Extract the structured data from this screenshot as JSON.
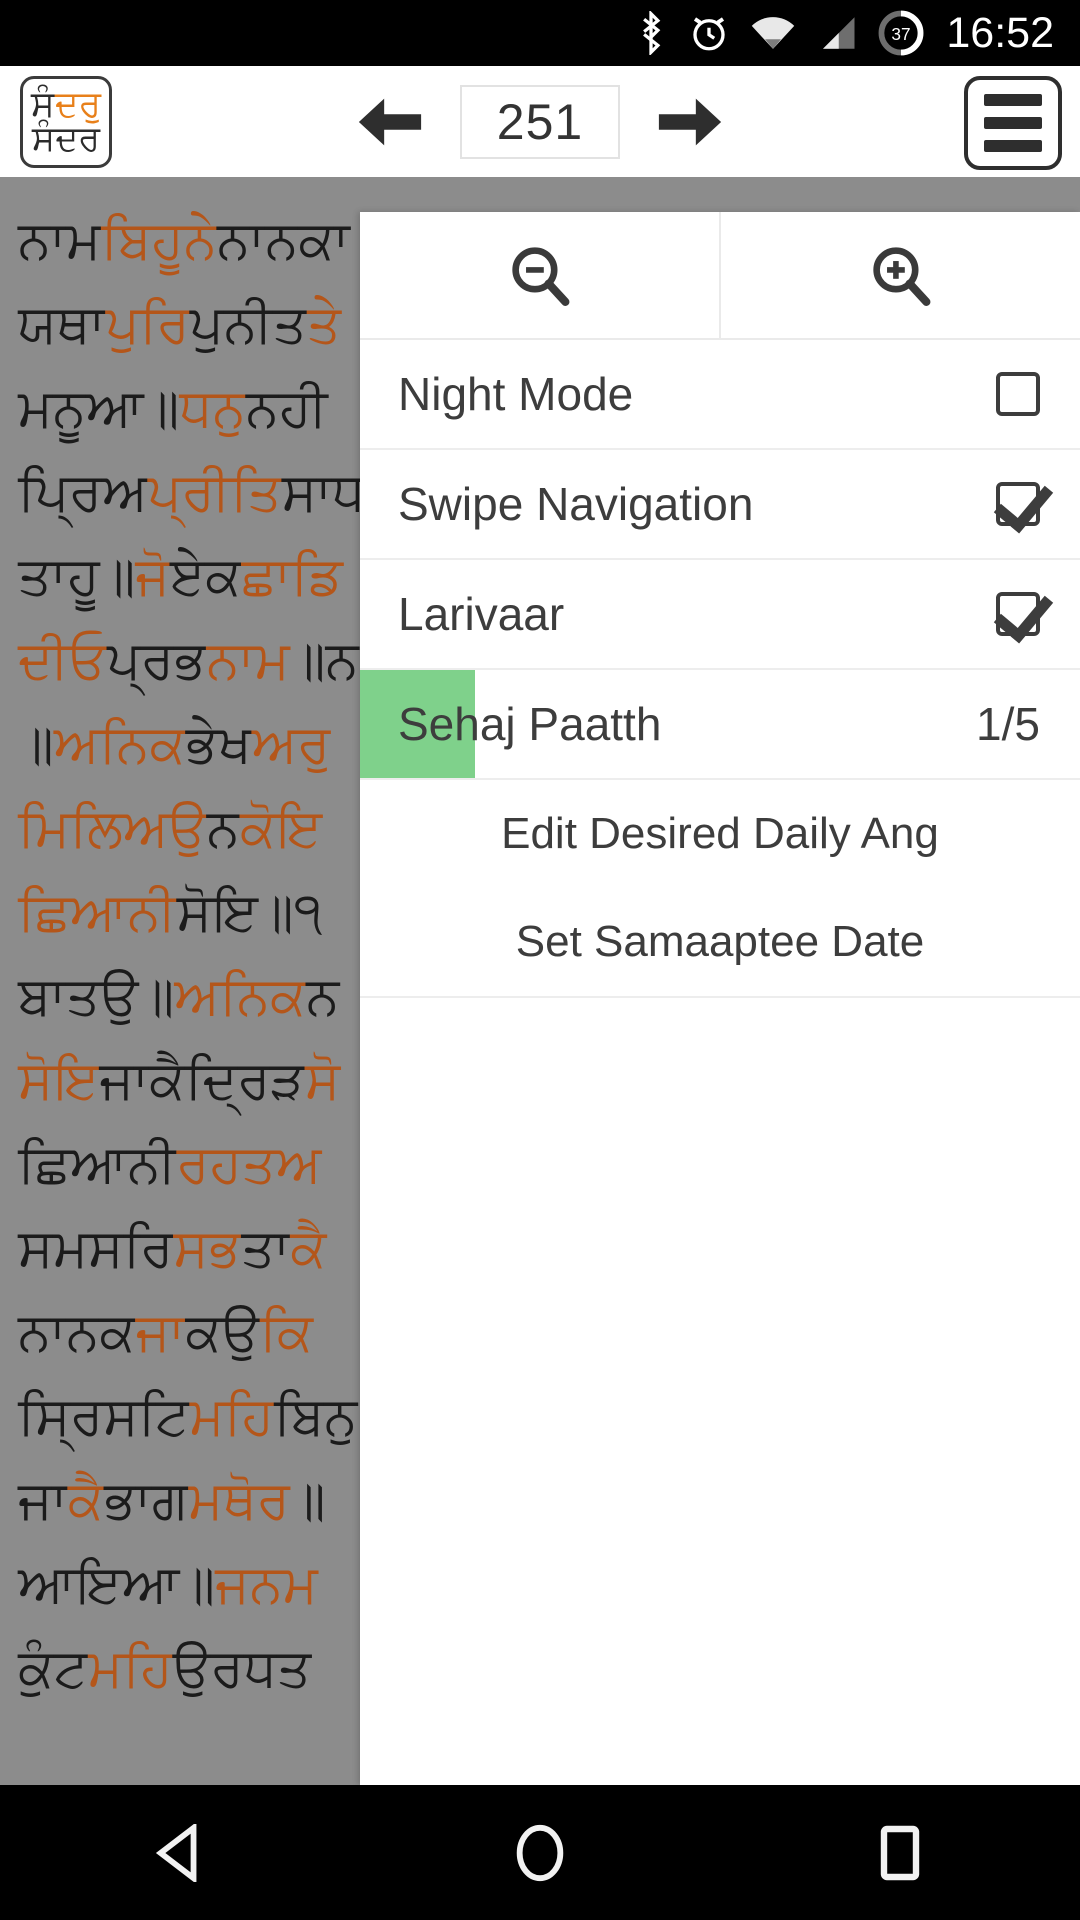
{
  "status_bar": {
    "time": "16:52",
    "battery_percent": "37",
    "icons": [
      "bluetooth-icon",
      "alarm-icon",
      "wifi-icon",
      "cellular-signal-icon",
      "battery-icon"
    ]
  },
  "app_bar": {
    "logo": {
      "line1_plain": "ਸੰ",
      "line1_highlight": "ਦਰੁ",
      "line2": "ਸੰਦਰ"
    },
    "prev_label": "←",
    "next_label": "→",
    "ang_number": "251",
    "menu_icon": "hamburger-icon"
  },
  "menu": {
    "zoom_out_icon": "zoom-out-icon",
    "zoom_in_icon": "zoom-in-icon",
    "items": [
      {
        "label": "Night Mode",
        "control": "checkbox",
        "checked": false
      },
      {
        "label": "Swipe Navigation",
        "control": "checkbox",
        "checked": true
      },
      {
        "label": "Larivaar",
        "control": "checkbox",
        "checked": true
      },
      {
        "label": "Sehaj Paatth",
        "control": "counter",
        "value": "1/5",
        "progress_percent": 16
      }
    ],
    "sub_items": [
      {
        "label": "Edit Desired Daily Ang"
      },
      {
        "label": "Set Samaaptee Date"
      }
    ],
    "progress_color": "#7fd18b"
  },
  "scripture": {
    "lines": [
      [
        {
          "t": "ਨਾਮ",
          "c": "k"
        },
        {
          "t": "ਬਿਹੂਨੇ",
          "c": "o"
        },
        {
          "t": "ਨਾਨਕਾ",
          "c": "k"
        }
      ],
      [
        {
          "t": "ਯਥਾ",
          "c": "k"
        },
        {
          "t": "ਪੁਰਿ",
          "c": "o"
        },
        {
          "t": "ਪੁਨੀਤ",
          "c": "k"
        },
        {
          "t": "ਤੇ",
          "c": "o"
        }
      ],
      [
        {
          "t": "ਮਨੂਆ॥",
          "c": "k"
        },
        {
          "t": "ਧਨੁ",
          "c": "o"
        },
        {
          "t": "ਨਹੀ",
          "c": "k"
        }
      ],
      [
        {
          "t": "ਪ੍ਰਿਅ",
          "c": "k"
        },
        {
          "t": "ਪ੍ਰੀਤਿ",
          "c": "o"
        },
        {
          "t": "ਸਾਧਰ",
          "c": "k"
        }
      ],
      [
        {
          "t": "ਤਾਹੂ॥",
          "c": "k"
        },
        {
          "t": "ਜੋ",
          "c": "o"
        },
        {
          "t": "ਏਕ",
          "c": "k"
        },
        {
          "t": "ਛਾਡਿ",
          "c": "o"
        }
      ],
      [
        {
          "t": "ਦੀਓ",
          "c": "o"
        },
        {
          "t": "ਪ੍ਰਭ",
          "c": "k"
        },
        {
          "t": "ਨਾਮ",
          "c": "o"
        },
        {
          "t": "॥ਨ",
          "c": "k"
        }
      ],
      [
        {
          "t": "॥",
          "c": "k"
        },
        {
          "t": "ਅਨਿਕ",
          "c": "o"
        },
        {
          "t": "ਭੇਖ",
          "c": "k"
        },
        {
          "t": "ਅਰੁ",
          "c": "o"
        }
      ],
      [
        {
          "t": "ਮਿਲਿਅਉ",
          "c": "o"
        },
        {
          "t": "ਨ",
          "c": "k"
        },
        {
          "t": "ਕੋਇ",
          "c": "o"
        }
      ],
      [
        {
          "t": "ਛਿਆਨੀ",
          "c": "o"
        },
        {
          "t": "ਸੋਇ॥",
          "c": "k"
        },
        {
          "t": "੧",
          "c": "k"
        }
      ],
      [
        {
          "t": "ਬਾਤਉ॥",
          "c": "k"
        },
        {
          "t": "ਅਨਿਕ",
          "c": "o"
        },
        {
          "t": "ਨ",
          "c": "k"
        }
      ],
      [
        {
          "t": "ਸੋਇ",
          "c": "o"
        },
        {
          "t": "ਜਾ",
          "c": "k"
        },
        {
          "t": "ਕੈ",
          "c": "k"
        },
        {
          "t": "ਦ੍ਰਿੜ",
          "c": "k"
        },
        {
          "t": "ਸੋ",
          "c": "o"
        }
      ],
      [
        {
          "t": "ਛਿਆਨੀ",
          "c": "k"
        },
        {
          "t": "ਰਹਤਅ",
          "c": "o"
        }
      ],
      [
        {
          "t": "ਸਮਸਰਿ",
          "c": "k"
        },
        {
          "t": "ਸਭ",
          "c": "o"
        },
        {
          "t": "ਤਾ",
          "c": "k"
        },
        {
          "t": "ਕੈ",
          "c": "o"
        }
      ],
      [
        {
          "t": "ਨਾਨਕ",
          "c": "k"
        },
        {
          "t": "ਜਾ",
          "c": "o"
        },
        {
          "t": "ਕਉ",
          "c": "k"
        },
        {
          "t": "ਕਿ",
          "c": "o"
        }
      ],
      [
        {
          "t": "ਸ੍ਰਿਸਟਿ",
          "c": "k"
        },
        {
          "t": "ਮਹਿ",
          "c": "o"
        },
        {
          "t": "ਬਿਨੁ",
          "c": "k"
        }
      ],
      [
        {
          "t": "ਜਾ",
          "c": "k"
        },
        {
          "t": "ਕੈ",
          "c": "o"
        },
        {
          "t": "ਭਾਗ",
          "c": "k"
        },
        {
          "t": "ਮਥੋਰ",
          "c": "o"
        },
        {
          "t": "॥",
          "c": "k"
        }
      ],
      [
        {
          "t": "ਆਇਆ॥",
          "c": "k"
        },
        {
          "t": "ਜਨਮ",
          "c": "o"
        }
      ],
      [
        {
          "t": "ਕੁੰਟ",
          "c": "k"
        },
        {
          "t": "ਮਹਿ",
          "c": "o"
        },
        {
          "t": "ਉਰਧਤ",
          "c": "k"
        }
      ]
    ]
  },
  "nav_bar": {
    "back_icon": "back-triangle-icon",
    "home_icon": "home-circle-icon",
    "recents_icon": "recents-square-icon"
  }
}
